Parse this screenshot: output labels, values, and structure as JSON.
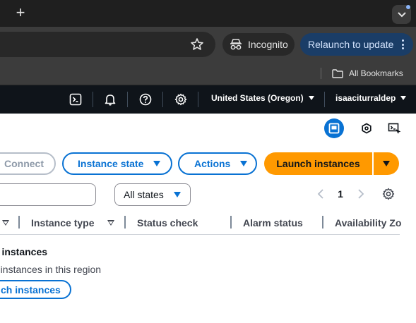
{
  "browser": {
    "new_tab_symbol": "+",
    "incognito_label": "Incognito",
    "relaunch_label": "Relaunch to update",
    "bookmarks_label": "All Bookmarks",
    "icons": [
      "plus-icon",
      "chevron-down-icon",
      "star-icon",
      "incognito-icon",
      "kebab-menu-icon",
      "folder-icon"
    ],
    "colors": {
      "tabstrip": "#1f1f1f",
      "toolbar": "#3c3c3c",
      "relaunch_bg": "#1a3d67"
    }
  },
  "aws_header": {
    "region": "United States (Oregon)",
    "account": "isaaciturraldep",
    "icons": [
      "cloudshell-icon",
      "bell-icon",
      "help-icon",
      "settings-icon"
    ]
  },
  "toolbar": {
    "connect_label": "Connect",
    "instance_state_label": "Instance state",
    "actions_label": "Actions",
    "launch_label": "Launch instances",
    "launch_color": "#ff9900"
  },
  "filters": {
    "search_value": "",
    "state_select": "All states",
    "page_number": "1"
  },
  "table": {
    "columns": [
      "Instance type",
      "Status check",
      "Alarm status",
      "Availability Zo"
    ]
  },
  "empty_state": {
    "title": "o instances",
    "description": "ny instances in this region",
    "action_label": "ch instances"
  }
}
